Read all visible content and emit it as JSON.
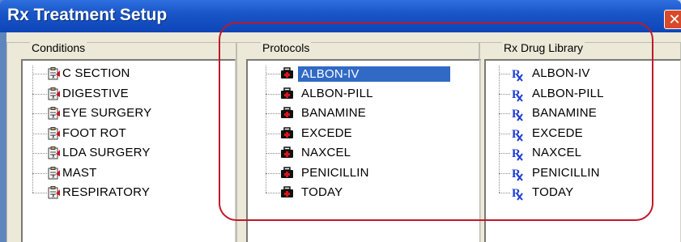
{
  "window": {
    "title": "Rx Treatment Setup",
    "close_glyph": "✕"
  },
  "conditions": {
    "label": "Conditions",
    "items": [
      "C SECTION",
      "DIGESTIVE",
      "EYE SURGERY",
      "FOOT ROT",
      "LDA SURGERY",
      "MAST",
      "RESPIRATORY"
    ]
  },
  "protocols": {
    "label": "Protocols",
    "selected": "ALBON-IV",
    "items": [
      "ALBON-IV",
      "ALBON-PILL",
      "BANAMINE",
      "EXCEDE",
      "NAXCEL",
      "PENICILLIN",
      "TODAY"
    ]
  },
  "drug_library": {
    "label": "Rx Drug Library",
    "items": [
      "ALBON-IV",
      "ALBON-PILL",
      "BANAMINE",
      "EXCEDE",
      "NAXCEL",
      "PENICILLIN",
      "TODAY"
    ]
  },
  "icons": {
    "condition": "clipboard-icon",
    "protocol": "medical-kit-icon",
    "drug": "rx-icon"
  },
  "colors": {
    "selection": "#316ac5",
    "annotation": "#c0182a",
    "titlebar": "#1a56c8"
  }
}
